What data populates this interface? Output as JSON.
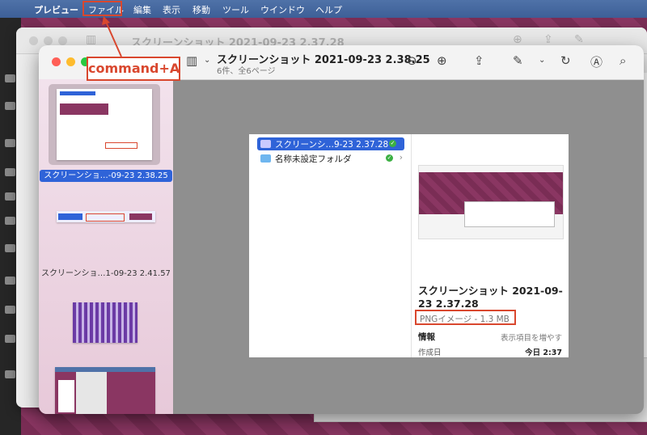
{
  "menubar": {
    "apple_icon": "apple-icon",
    "items": [
      "プレビュー",
      "ファイル",
      "編集",
      "表示",
      "移動",
      "ツール",
      "ウインドウ",
      "ヘルプ"
    ]
  },
  "back_window": {
    "title": "スクリーンショット 2021-09-23 2.37.28"
  },
  "front_window": {
    "title": "スクリーンショット 2021-09-23 2.38.25",
    "subtitle": "6件、全6ページ"
  },
  "sidebar": {
    "items": [
      {
        "caption": "スクリーンショ…-09-23 2.38.25",
        "selected": true
      },
      {
        "caption": "スクリーンショ…1-09-23 2.41.57",
        "selected": false
      }
    ]
  },
  "document": {
    "rows": [
      {
        "label": "スクリーンシ…9-23 2.37.28"
      },
      {
        "label": "名称未設定フォルダ"
      }
    ],
    "info": {
      "name": "スクリーンショット 2021-09-23 2.37.28",
      "type": "PNGイメージ - 1.3 MB",
      "section": "情報",
      "more": "表示項目を増やす",
      "created_label": "作成日",
      "created_value": "今日 2:37"
    }
  },
  "annotation": {
    "text": "command+A"
  },
  "colors": {
    "highlight": "#d9472e",
    "selection": "#2f63d8",
    "menubar": "#4466a0"
  }
}
